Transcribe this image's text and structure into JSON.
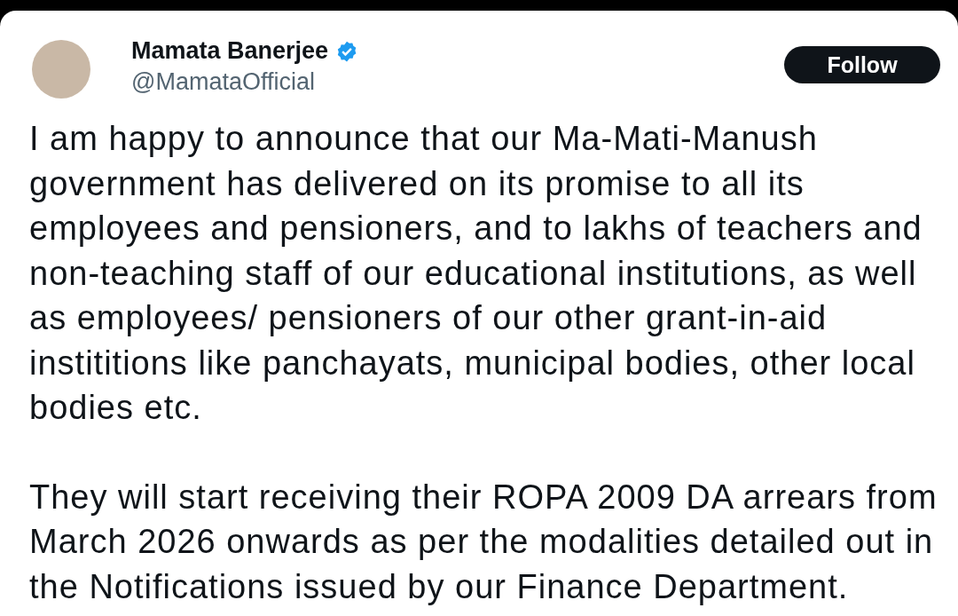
{
  "author": {
    "name": "Mamata Banerjee",
    "verified": true,
    "handle": "@MamataOfficial"
  },
  "follow_button": {
    "label": "Follow"
  },
  "paragraphs": [
    "I am happy to announce that our Ma-Mati-Manush government has delivered on its promise to all its employees and pensioners, and to lakhs of teachers and non-teaching staff of our educational institutions, as well as employees/ pensioners of our other grant-in-aid instititions like panchayats, municipal bodies, other local bodies etc.",
    "They will start receiving their ROPA 2009 DA arrears from March 2026 onwards as per the modalities detailed out in the Notifications issued by our Finance Department."
  ]
}
